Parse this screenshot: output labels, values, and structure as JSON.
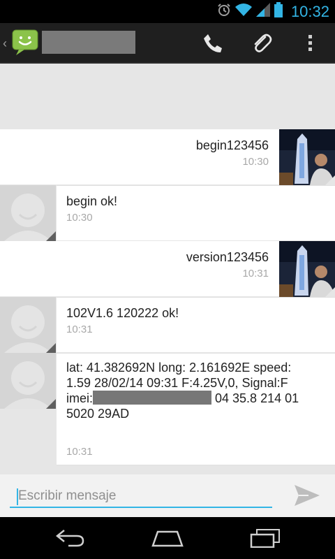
{
  "status_bar": {
    "time": "10:32",
    "icons": [
      "alarm-icon",
      "wifi-icon",
      "signal-icon",
      "battery-icon"
    ],
    "accent_color": "#33b5e5"
  },
  "action_bar": {
    "app_icon": "messaging-app-icon",
    "actions": [
      "phone-icon",
      "attach-icon",
      "overflow-menu-icon"
    ]
  },
  "messages": [
    {
      "direction": "out",
      "text": "begin123456",
      "time": "10:30"
    },
    {
      "direction": "in",
      "text": "begin ok!",
      "time": "10:30"
    },
    {
      "direction": "out",
      "text": "version123456",
      "time": "10:31"
    },
    {
      "direction": "in",
      "text": "102V1.6 120222 ok!",
      "time": "10:31"
    },
    {
      "direction": "in",
      "line1": "lat: 41.382692N long: 2.161692E speed:",
      "line2": "1.59 28/02/14 09:31 F:4.25V,0, Signal:F",
      "line3_prefix": "imei:",
      "line3_suffix": " 04 35.8 214 01",
      "line4": "5020 29AD",
      "time": "10:31"
    }
  ],
  "compose": {
    "placeholder": "Escribir mensaje"
  },
  "nav_bar": {
    "buttons": [
      "back-icon",
      "home-icon",
      "recent-apps-icon"
    ]
  }
}
